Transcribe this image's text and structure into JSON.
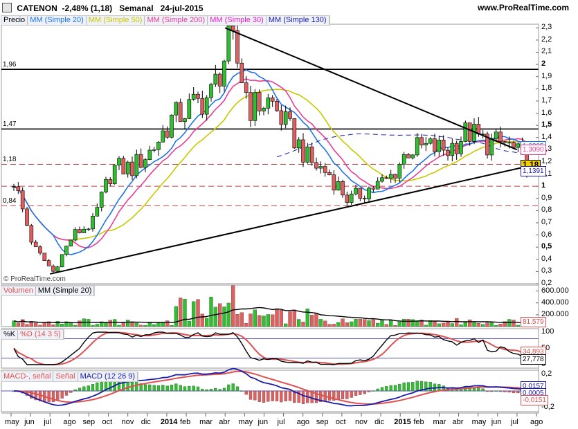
{
  "header": {
    "symbol": "CATENON",
    "change": "-2,48% (1,18)",
    "period": "Semanal",
    "date": "24-jul-2015",
    "site": "www.ProRealTime.com"
  },
  "watermark": "© ProRealTime.com",
  "price_panel": {
    "legend": [
      {
        "label": "Precio",
        "color": "#000000"
      },
      {
        "label": "MM (Simple 20)",
        "color": "#1e73e8"
      },
      {
        "label": "MM (Simple 50)",
        "color": "#c8c800"
      },
      {
        "label": "MM (Simple 200)",
        "color": "#e83c96"
      },
      {
        "label": "MM (Simple 30)",
        "color": "#e020c0"
      },
      {
        "label": "MM (Simple 130)",
        "color": "#1a1aa8"
      }
    ],
    "y_ticks": [
      "2,3",
      "2,2",
      "2,1",
      "2",
      "1,9",
      "1,8",
      "1,7",
      "1,6",
      "1,5",
      "1,4",
      "1,3",
      "1,2",
      "1,1",
      "1",
      "0,9",
      "0,8",
      "0,7",
      "0,6",
      "0,5",
      "0,4",
      "0,3",
      "0,2"
    ],
    "levels": [
      "1,96",
      "1,47",
      "1,18",
      "0,84"
    ],
    "badges": [
      {
        "text": "1,3285",
        "color": "#1e73e8"
      },
      {
        "text": "1,3090",
        "color": "#e83c96"
      },
      {
        "text": "1,18",
        "color": "#000000"
      },
      {
        "text": "1,1391",
        "color": "#1a1aa8"
      }
    ]
  },
  "volume_panel": {
    "legend": [
      {
        "label": "Volumen",
        "color": "#e05050"
      },
      {
        "label": "MM (Simple 20)",
        "color": "#000000"
      }
    ],
    "y_ticks": [
      "600.000",
      "400.000",
      "200.000"
    ],
    "badges": [
      {
        "text": "81.579",
        "color": "#e05050"
      }
    ]
  },
  "stoch_panel": {
    "legend": [
      {
        "label": "%K",
        "color": "#000000"
      },
      {
        "label": "%D (14 3 5)",
        "color": "#e05050"
      }
    ],
    "y_ticks": [
      "100",
      "50",
      "0"
    ],
    "badges": [
      {
        "text": "34,893",
        "color": "#e05050"
      },
      {
        "text": "27,778",
        "color": "#000000"
      }
    ]
  },
  "macd_panel": {
    "legend": [
      {
        "label": "MACD-, señal",
        "color": "#e05050"
      },
      {
        "label": "Señal",
        "color": "#e05050"
      },
      {
        "label": "MACD (12 26 9)",
        "color": "#1a1aa8"
      }
    ],
    "y_ticks": [
      "0,2",
      "0",
      "-0,2"
    ],
    "badges": [
      {
        "text": "0,0157",
        "color": "#1a1aa8"
      },
      {
        "text": "0,0005",
        "color": "#1a1aa8"
      },
      {
        "text": "-0,0151",
        "color": "#e05050"
      }
    ]
  },
  "x_axis": {
    "labels": [
      {
        "text": "may",
        "bold": false
      },
      {
        "text": "jun",
        "bold": false
      },
      {
        "text": "jul",
        "bold": false
      },
      {
        "text": "ago",
        "bold": false
      },
      {
        "text": "sep",
        "bold": false
      },
      {
        "text": "oct",
        "bold": false
      },
      {
        "text": "nov",
        "bold": false
      },
      {
        "text": "dic",
        "bold": false
      },
      {
        "text": "2014",
        "bold": true
      },
      {
        "text": "feb",
        "bold": false
      },
      {
        "text": "mar",
        "bold": false
      },
      {
        "text": "abr",
        "bold": false
      },
      {
        "text": "may",
        "bold": false
      },
      {
        "text": "jun",
        "bold": false
      },
      {
        "text": "jul",
        "bold": false
      },
      {
        "text": "ago",
        "bold": false
      },
      {
        "text": "sep",
        "bold": false
      },
      {
        "text": "oct",
        "bold": false
      },
      {
        "text": "nov",
        "bold": false
      },
      {
        "text": "dic",
        "bold": false
      },
      {
        "text": "2015",
        "bold": true
      },
      {
        "text": "feb",
        "bold": false
      },
      {
        "text": "mar",
        "bold": false
      },
      {
        "text": "abr",
        "bold": false
      },
      {
        "text": "may",
        "bold": false
      },
      {
        "text": "jun",
        "bold": false
      },
      {
        "text": "jul",
        "bold": false
      },
      {
        "text": "ago",
        "bold": false
      }
    ]
  },
  "chart_data": {
    "type": "candlestick",
    "title": "CATENON",
    "ylim": [
      0.2,
      2.33
    ],
    "ma_last": {
      "sma20": 1.3285,
      "sma30": 1.309,
      "sma50": 1.21,
      "sma130": 1.1391
    },
    "close_path": [
      {
        "m": "may 2013",
        "v": 1.05
      },
      {
        "m": "jun 2013",
        "v": 0.5
      },
      {
        "m": "jul 2013",
        "v": 0.3
      },
      {
        "m": "ago 2013",
        "v": 0.6
      },
      {
        "m": "sep 2013",
        "v": 0.7
      },
      {
        "m": "oct 2013",
        "v": 1.15
      },
      {
        "m": "nov 2013",
        "v": 1.15
      },
      {
        "m": "dic 2013",
        "v": 1.3
      },
      {
        "m": "2014",
        "v": 1.55
      },
      {
        "m": "feb 2014",
        "v": 1.65
      },
      {
        "m": "mar 2014",
        "v": 1.75
      },
      {
        "m": "abr 2014",
        "v": 2.2
      },
      {
        "m": "may 2014",
        "v": 1.65
      },
      {
        "m": "jun 2014",
        "v": 1.7
      },
      {
        "m": "jul 2014",
        "v": 1.45
      },
      {
        "m": "ago 2014",
        "v": 1.2
      },
      {
        "m": "sep 2014",
        "v": 1.1
      },
      {
        "m": "oct 2014",
        "v": 0.88
      },
      {
        "m": "nov 2014",
        "v": 0.98
      },
      {
        "m": "dic 2014",
        "v": 1.05
      },
      {
        "m": "2015",
        "v": 1.3
      },
      {
        "m": "feb 2015",
        "v": 1.32
      },
      {
        "m": "mar 2015",
        "v": 1.3
      },
      {
        "m": "abr 2015",
        "v": 1.45
      },
      {
        "m": "may 2015",
        "v": 1.35
      },
      {
        "m": "jun 2015",
        "v": 1.35
      },
      {
        "m": "jul 2015",
        "v": 1.18
      }
    ],
    "trendlines": [
      {
        "name": "resistance",
        "from": {
          "m": "abr 2014",
          "v": 2.3
        },
        "to": {
          "m": "jul 2015",
          "v": 1.3
        }
      },
      {
        "name": "support",
        "from": {
          "m": "jul 2013",
          "v": 0.28
        },
        "to": {
          "m": "ago 2015",
          "v": 1.18
        }
      }
    ],
    "volume_ylim": [
      0,
      700000
    ],
    "stochastic": {
      "k_last": 27.778,
      "d_last": 34.893
    },
    "macd": {
      "macd_last": 0.0005,
      "signal_last": 0.0157,
      "hist_last": -0.0151
    }
  }
}
